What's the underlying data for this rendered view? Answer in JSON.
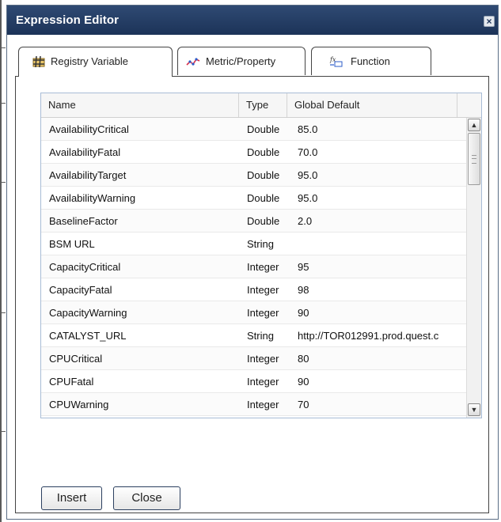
{
  "dialog": {
    "title": "Expression Editor",
    "close_glyph": "×"
  },
  "tabs": [
    {
      "label": "Registry Variable",
      "icon": "hash-icon",
      "active": true
    },
    {
      "label": "Metric/Property",
      "icon": "metric-icon",
      "active": false
    },
    {
      "label": "Function",
      "icon": "function-icon",
      "active": false
    }
  ],
  "grid": {
    "columns": [
      "Name",
      "Type",
      "Global Default"
    ],
    "rows": [
      {
        "name": "AvailabilityCritical",
        "type": "Double",
        "default": "85.0"
      },
      {
        "name": "AvailabilityFatal",
        "type": "Double",
        "default": "70.0"
      },
      {
        "name": "AvailabilityTarget",
        "type": "Double",
        "default": "95.0"
      },
      {
        "name": "AvailabilityWarning",
        "type": "Double",
        "default": "95.0"
      },
      {
        "name": "BaselineFactor",
        "type": "Double",
        "default": "2.0"
      },
      {
        "name": "BSM URL",
        "type": "String",
        "default": ""
      },
      {
        "name": "CapacityCritical",
        "type": "Integer",
        "default": "95"
      },
      {
        "name": "CapacityFatal",
        "type": "Integer",
        "default": "98"
      },
      {
        "name": "CapacityWarning",
        "type": "Integer",
        "default": "90"
      },
      {
        "name": "CATALYST_URL",
        "type": "String",
        "default": "http://TOR012991.prod.quest.c"
      },
      {
        "name": "CPUCritical",
        "type": "Integer",
        "default": "80"
      },
      {
        "name": "CPUFatal",
        "type": "Integer",
        "default": "90"
      },
      {
        "name": "CPUWarning",
        "type": "Integer",
        "default": "70"
      }
    ],
    "scroll_up_glyph": "▲",
    "scroll_down_glyph": "▼"
  },
  "buttons": {
    "insert_label": "Insert",
    "close_label": "Close"
  },
  "colors": {
    "titlebar": "#1c3358",
    "grid_border": "#a8bcd6"
  }
}
